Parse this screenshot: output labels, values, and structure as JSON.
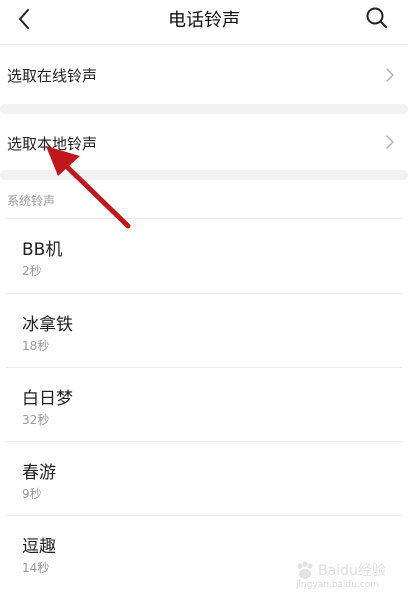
{
  "header": {
    "title": "电话铃声",
    "back_icon": "chevron-left-icon",
    "search_icon": "search-icon"
  },
  "options": [
    {
      "label": "选取在线铃声"
    },
    {
      "label": "选取本地铃声"
    }
  ],
  "section": {
    "label": "系统铃声"
  },
  "ringtones": [
    {
      "name": "BB机",
      "duration": "2秒"
    },
    {
      "name": "冰拿铁",
      "duration": "18秒"
    },
    {
      "name": "白日梦",
      "duration": "32秒"
    },
    {
      "name": "春游",
      "duration": "9秒"
    },
    {
      "name": "逗趣",
      "duration": "14秒"
    }
  ],
  "annotation": {
    "arrow_color": "#c0161d"
  },
  "watermark": {
    "text": "Baidu经验",
    "sub": "jingyan.baidu.com"
  }
}
